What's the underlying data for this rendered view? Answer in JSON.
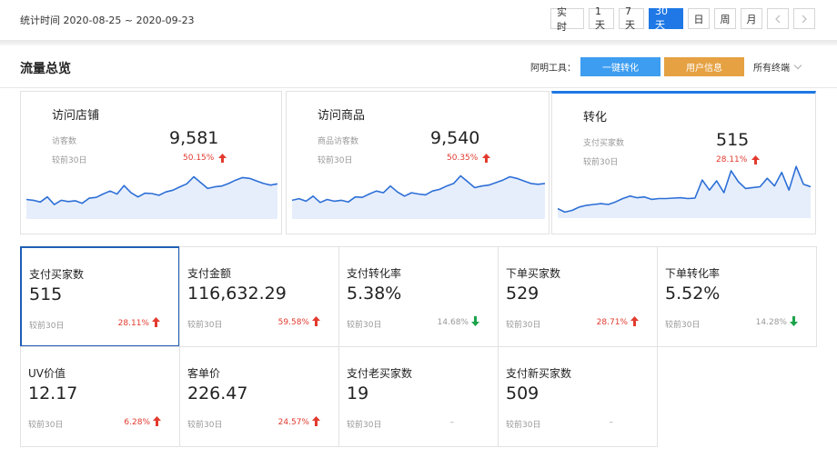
{
  "header": {
    "date_range": "统计时间 2020-08-25 ~ 2020-09-23",
    "range_buttons": [
      "实 时",
      "1天",
      "7天",
      "30天",
      "日",
      "周",
      "月"
    ],
    "active_range": "30天"
  },
  "section": {
    "title": "流量总览",
    "tools_label": "阿明工具：",
    "convert_button": "一键转化",
    "user_info_button": "用户信息",
    "terminal_select": "所有终端"
  },
  "panels": [
    {
      "title": "访问店铺",
      "label": "访客数",
      "value": "9,581",
      "compare": "较前30日",
      "pct": "50.15%",
      "trend": "up",
      "spark": [
        0.42,
        0.4,
        0.36,
        0.48,
        0.3,
        0.4,
        0.37,
        0.39,
        0.33,
        0.45,
        0.47,
        0.55,
        0.62,
        0.55,
        0.75,
        0.58,
        0.48,
        0.57,
        0.56,
        0.52,
        0.6,
        0.64,
        0.72,
        0.79,
        0.96,
        0.82,
        0.68,
        0.72,
        0.74,
        0.8,
        0.88,
        0.94,
        0.92,
        0.86,
        0.8,
        0.76,
        0.79
      ]
    },
    {
      "title": "访问商品",
      "label": "商品访客数",
      "value": "9,540",
      "compare": "较前30日",
      "pct": "50.35%",
      "trend": "up",
      "spark": [
        0.4,
        0.44,
        0.38,
        0.5,
        0.35,
        0.42,
        0.38,
        0.4,
        0.36,
        0.48,
        0.47,
        0.55,
        0.62,
        0.58,
        0.74,
        0.6,
        0.5,
        0.58,
        0.55,
        0.53,
        0.62,
        0.66,
        0.74,
        0.8,
        0.98,
        0.84,
        0.7,
        0.74,
        0.76,
        0.82,
        0.88,
        0.96,
        0.92,
        0.86,
        0.8,
        0.78,
        0.8
      ]
    },
    {
      "title": "转化",
      "label": "支付买家数",
      "value": "515",
      "compare": "较前30日",
      "pct": "28.11%",
      "trend": "up",
      "spark": [
        0.18,
        0.1,
        0.14,
        0.22,
        0.26,
        0.28,
        0.3,
        0.28,
        0.34,
        0.42,
        0.48,
        0.44,
        0.46,
        0.4,
        0.42,
        0.42,
        0.43,
        0.44,
        0.42,
        0.43,
        0.86,
        0.62,
        0.84,
        0.56,
        1.08,
        0.82,
        0.66,
        0.68,
        0.7,
        0.9,
        0.72,
        1.04,
        0.62,
        1.18,
        0.76,
        0.7
      ]
    }
  ],
  "cards": [
    {
      "label": "支付买家数",
      "value": "515",
      "compare": "较前30日",
      "pct": "28.11%",
      "trend": "up"
    },
    {
      "label": "支付金额",
      "value": "116,632.29",
      "compare": "较前30日",
      "pct": "59.58%",
      "trend": "up"
    },
    {
      "label": "支付转化率",
      "value": "5.38%",
      "compare": "较前30日",
      "pct": "14.68%",
      "trend": "down"
    },
    {
      "label": "下单买家数",
      "value": "529",
      "compare": "较前30日",
      "pct": "28.71%",
      "trend": "up"
    },
    {
      "label": "下单转化率",
      "value": "5.52%",
      "compare": "较前30日",
      "pct": "14.28%",
      "trend": "down"
    },
    {
      "label": "UV价值",
      "value": "12.17",
      "compare": "较前30日",
      "pct": "6.28%",
      "trend": "up"
    },
    {
      "label": "客单价",
      "value": "226.47",
      "compare": "较前30日",
      "pct": "24.57%",
      "trend": "up"
    },
    {
      "label": "支付老买家数",
      "value": "19",
      "compare": "较前30日",
      "pct": "–",
      "trend": "none"
    },
    {
      "label": "支付新买家数",
      "value": "509",
      "compare": "较前30日",
      "pct": "–",
      "trend": "none"
    }
  ],
  "colors": {
    "primary": "#1f78e5",
    "up": "#e23a2e",
    "down": "#1aa34a",
    "orange": "#e5a142",
    "line": "#2d6fd6",
    "fill": "#e6eefc"
  }
}
